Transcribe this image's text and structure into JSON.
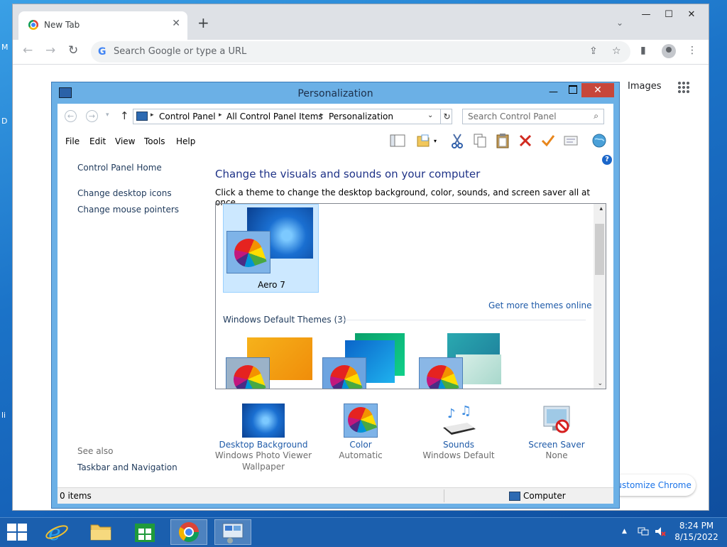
{
  "desktop": {
    "fragments": [
      "M",
      "D",
      "li"
    ]
  },
  "chrome": {
    "tab_title": "New Tab",
    "tab_close": "✕",
    "new_tab": "+",
    "tab_menu": "⌄",
    "window_min": "—",
    "window_max": "☐",
    "window_close": "✕",
    "back": "←",
    "forward": "→",
    "reload": "↻",
    "google_g": "G",
    "omnibox_placeholder": "Search Google or type a URL",
    "share": "⇪",
    "bookmark": "☆",
    "side_panel": "▮",
    "menu": "⋮",
    "images_link": "Images",
    "customize_label": "Customize Chrome"
  },
  "personalization": {
    "title": "Personalization",
    "min": "—",
    "close": "✕",
    "back": "←",
    "forward": "→",
    "recent": "▾",
    "up": "↑",
    "breadcrumbs": [
      "Control Panel",
      "All Control Panel Items",
      "Personalization"
    ],
    "crumb_sep": "▸",
    "address_dropdown": "⌄",
    "refresh": "↻",
    "search_placeholder": "Search Control Panel",
    "search_icon": "⌕",
    "menu": [
      "File",
      "Edit",
      "View",
      "Tools",
      "Help"
    ],
    "toolbar_icons": [
      "layout-icon",
      "folder-options-icon",
      "cut-icon",
      "copy-icon",
      "paste-icon",
      "delete-icon",
      "check-icon",
      "properties-icon",
      "globe-icon"
    ],
    "help": "?",
    "left_links": [
      "Control Panel Home",
      "Change desktop icons",
      "Change mouse pointers"
    ],
    "see_also": "See also",
    "see_also_links": [
      "Taskbar and Navigation"
    ],
    "heading": "Change the visuals and sounds on your computer",
    "subheading": "Click a theme to change the desktop background, color, sounds, and screen saver all at once.",
    "scroll_up": "▴",
    "scroll_down": "⌄",
    "selected_theme": "Aero 7",
    "more_themes": "Get more themes online",
    "group_label": "Windows Default Themes (3)",
    "bottom_items": [
      {
        "title": "Desktop Background",
        "sub1": "Windows Photo Viewer",
        "sub2": "Wallpaper"
      },
      {
        "title": "Color",
        "sub1": "Automatic",
        "sub2": ""
      },
      {
        "title": "Sounds",
        "sub1": "Windows Default",
        "sub2": ""
      },
      {
        "title": "Screen Saver",
        "sub1": "None",
        "sub2": ""
      }
    ],
    "status_left": "0 items",
    "status_right": "Computer"
  },
  "taskbar": {
    "apps": [
      "internet-explorer",
      "file-explorer",
      "store",
      "chrome",
      "control-panel"
    ],
    "tray_chevron": "▲",
    "time": "8:24 PM",
    "date": "8/15/2022"
  },
  "colors": {
    "accent": "#1e5aa8",
    "window_frame": "#6bb0e6",
    "close_red": "#c7463a",
    "taskbar": "#1b5fae"
  }
}
